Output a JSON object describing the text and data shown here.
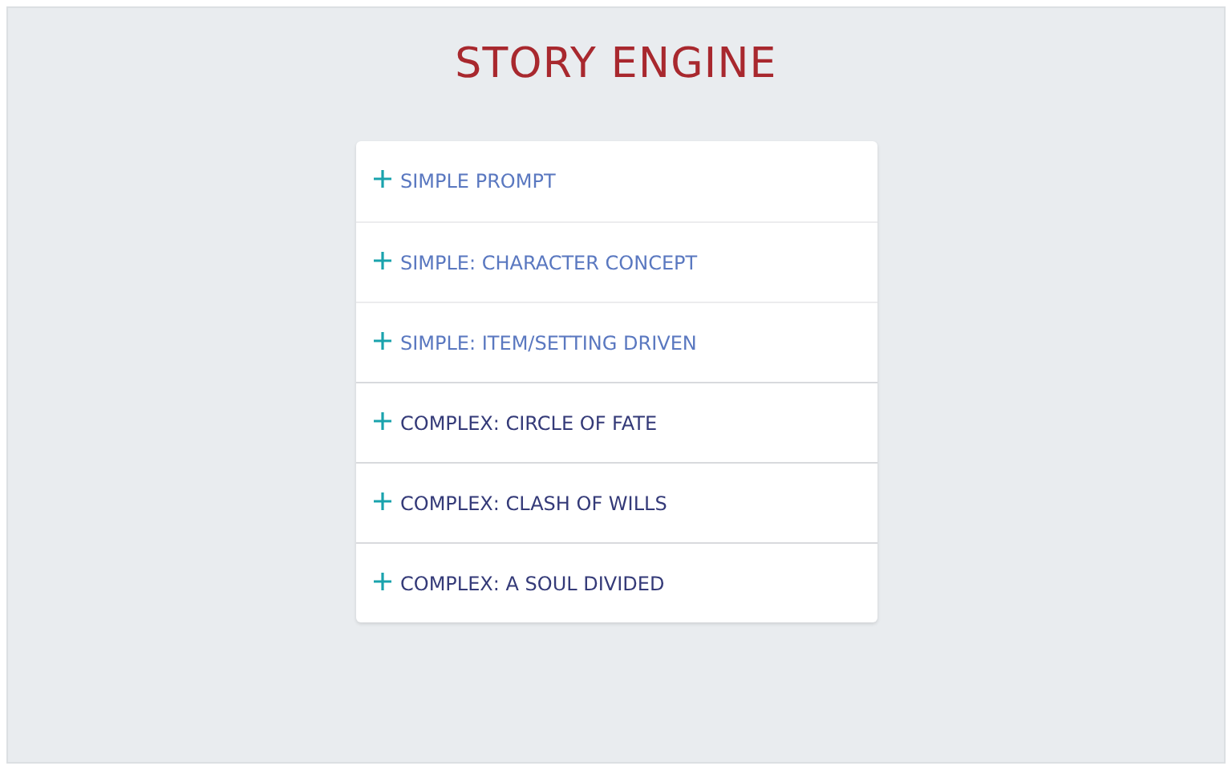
{
  "title": "STORY ENGINE",
  "items": [
    {
      "label": "SIMPLE PROMPT",
      "kind": "simple",
      "expanded": false
    },
    {
      "label": "SIMPLE: CHARACTER CONCEPT",
      "kind": "simple",
      "expanded": false
    },
    {
      "label": "SIMPLE: ITEM/SETTING DRIVEN",
      "kind": "simple",
      "expanded": false
    },
    {
      "label": "COMPLEX: CIRCLE OF FATE",
      "kind": "complex",
      "expanded": false
    },
    {
      "label": "COMPLEX: CLASH OF WILLS",
      "kind": "complex",
      "expanded": false
    },
    {
      "label": "COMPLEX: A SOUL DIVIDED",
      "kind": "complex",
      "expanded": false
    }
  ]
}
